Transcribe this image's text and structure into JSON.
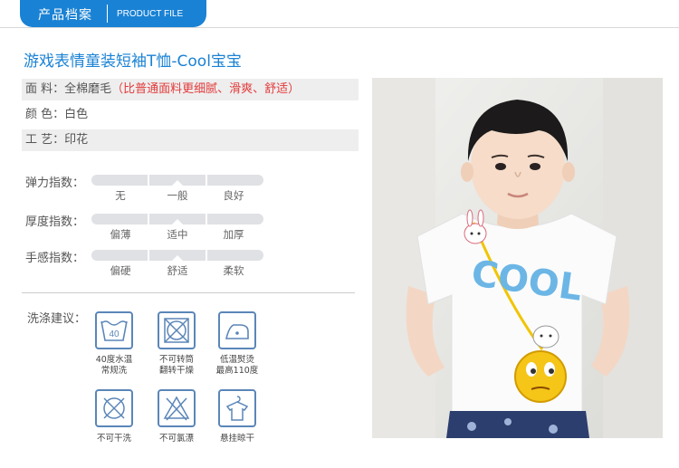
{
  "header": {
    "tab_cn": "产品档案",
    "tab_en": "PRODUCT FILE"
  },
  "product": {
    "title": "游戏表情童装短袖T恤-Cool宝宝"
  },
  "specs": [
    {
      "label": "面 料：",
      "value": "全棉磨毛",
      "note": "（比普通面料更细腻、滑爽、舒适）"
    },
    {
      "label": "颜 色：",
      "value": "白色"
    },
    {
      "label": "工 艺：",
      "value": "印花"
    }
  ],
  "scales": [
    {
      "label": "弹力指数：",
      "ticks": [
        "无",
        "一般",
        "良好"
      ],
      "selected": 1
    },
    {
      "label": "厚度指数：",
      "ticks": [
        "偏薄",
        "适中",
        "加厚"
      ],
      "selected": 1
    },
    {
      "label": "手感指数：",
      "ticks": [
        "偏硬",
        "舒适",
        "柔软"
      ],
      "selected": 1
    }
  ],
  "care": {
    "label": "洗涤建议：",
    "items": [
      {
        "icon": "wash-40-icon",
        "badge": "40",
        "caption_lines": [
          "40度水温",
          "常规洗"
        ]
      },
      {
        "icon": "no-tumble-dry-icon",
        "caption_lines": [
          "不可转筒",
          "翻转干燥"
        ]
      },
      {
        "icon": "iron-low-icon",
        "caption_lines": [
          "低温熨烫",
          "最高110度"
        ]
      },
      {
        "icon": "no-dry-clean-icon",
        "caption_lines": [
          "不可干洗"
        ]
      },
      {
        "icon": "no-bleach-icon",
        "caption_lines": [
          "不可氯漂"
        ]
      },
      {
        "icon": "hang-dry-icon",
        "caption_lines": [
          "悬挂晾干"
        ]
      }
    ]
  },
  "photo": {
    "shirt_print": "COOL"
  },
  "colors": {
    "accent": "#1a82d4",
    "highlight": "#e33b3b",
    "icon": "#5b86b8",
    "shaded_row": "#eeeeee",
    "track": "#dfe1e4"
  }
}
